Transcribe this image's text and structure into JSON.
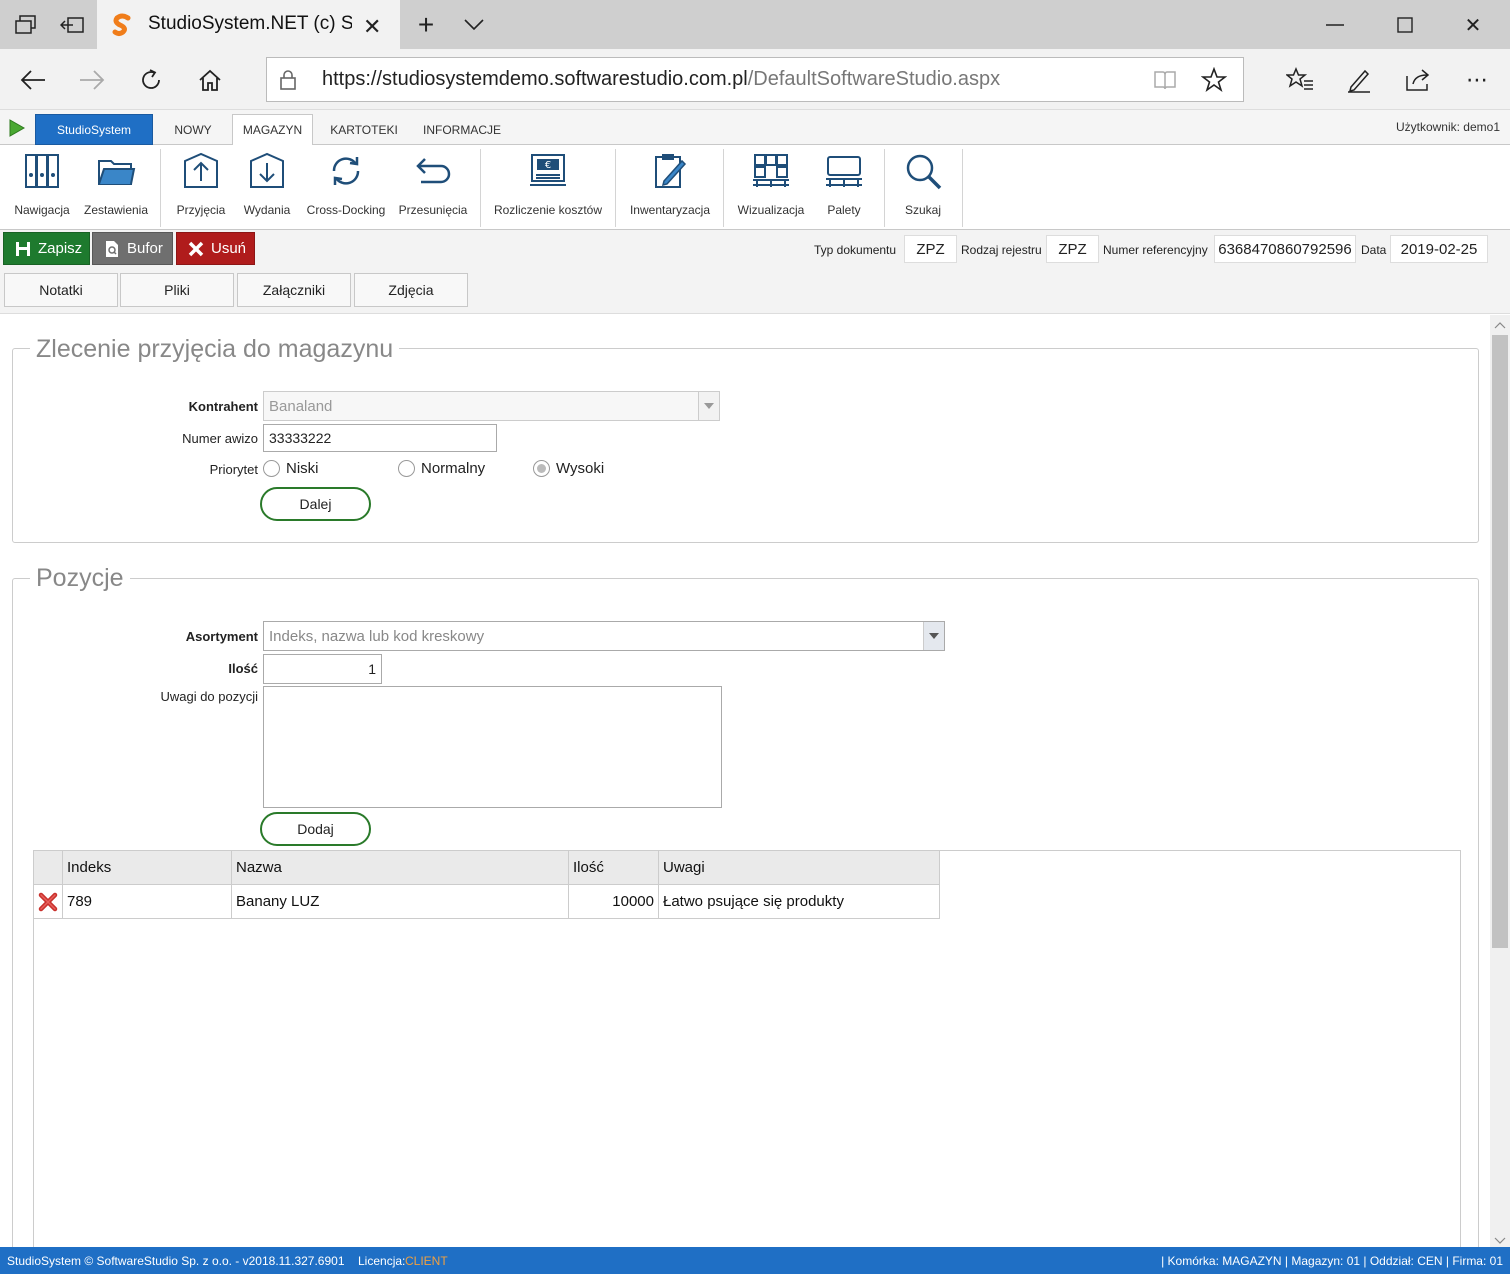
{
  "browser": {
    "tab_title": "StudioSystem.NET (c) So",
    "url_host": "https://studiosystemdemo.softwarestudio.com.pl",
    "url_path": "/DefaultSoftwareStudio.aspx"
  },
  "ribbon_tabs": {
    "app": "StudioSystem",
    "items": [
      "NOWY",
      "MAGAZYN",
      "KARTOTEKI",
      "INFORMACJE"
    ],
    "user": "Użytkownik: demo1"
  },
  "ribbon": {
    "buttons": [
      "Nawigacja",
      "Zestawienia",
      "Przyjęcia",
      "Wydania",
      "Cross-Docking",
      "Przesunięcia",
      "Rozliczenie kosztów",
      "Inwentaryzacja",
      "Wizualizacja",
      "Palety",
      "Szukaj"
    ]
  },
  "toolbar": {
    "save": "Zapisz",
    "buffer": "Bufor",
    "delete": "Usuń",
    "doc_type_label": "Typ dokumentu",
    "doc_type": "ZPZ",
    "reg_type_label": "Rodzaj rejestru",
    "reg_type": "ZPZ",
    "ref_label": "Numer referencyjny",
    "ref_number": "6368470860792596",
    "date_label": "Data",
    "date": "2019-02-25",
    "subtabs": [
      "Notatki",
      "Pliki",
      "Załączniki",
      "Zdjęcia"
    ]
  },
  "order": {
    "legend": "Zlecenie przyjęcia do magazynu",
    "contractor_label": "Kontrahent",
    "contractor_value": "Banaland",
    "notice_label": "Numer awizo",
    "notice_value": "33333222",
    "priority_label": "Priorytet",
    "priority_options": [
      "Niski",
      "Normalny",
      "Wysoki"
    ],
    "priority_selected": "Wysoki",
    "next_button": "Dalej"
  },
  "positions": {
    "legend": "Pozycje",
    "assortment_label": "Asortyment",
    "assortment_placeholder": "Indeks, nazwa lub kod kreskowy",
    "qty_label": "Ilość",
    "qty_value": "1",
    "notes_label": "Uwagi do pozycji",
    "add_button": "Dodaj",
    "columns": [
      "Indeks",
      "Nazwa",
      "Ilość",
      "Uwagi"
    ],
    "rows": [
      {
        "index": "789",
        "name": "Banany LUZ",
        "qty": "10000",
        "notes": "Łatwo psujące się produkty"
      }
    ]
  },
  "status": {
    "left": "StudioSystem © SoftwareStudio Sp. z o.o. - v2018.11.327.6901",
    "license_label": "Licencja:",
    "license_value": "CLIENT",
    "right": "| Komórka: MAGAZYN | Magazyn: 01 | Oddział: CEN | Firma: 01"
  },
  "colors": {
    "brand_blue": "#1f6fc5",
    "save_green": "#1e7a2e",
    "buffer_gray": "#6f6f6f",
    "delete_red": "#b01c1c",
    "license_orange": "#f0a040"
  }
}
